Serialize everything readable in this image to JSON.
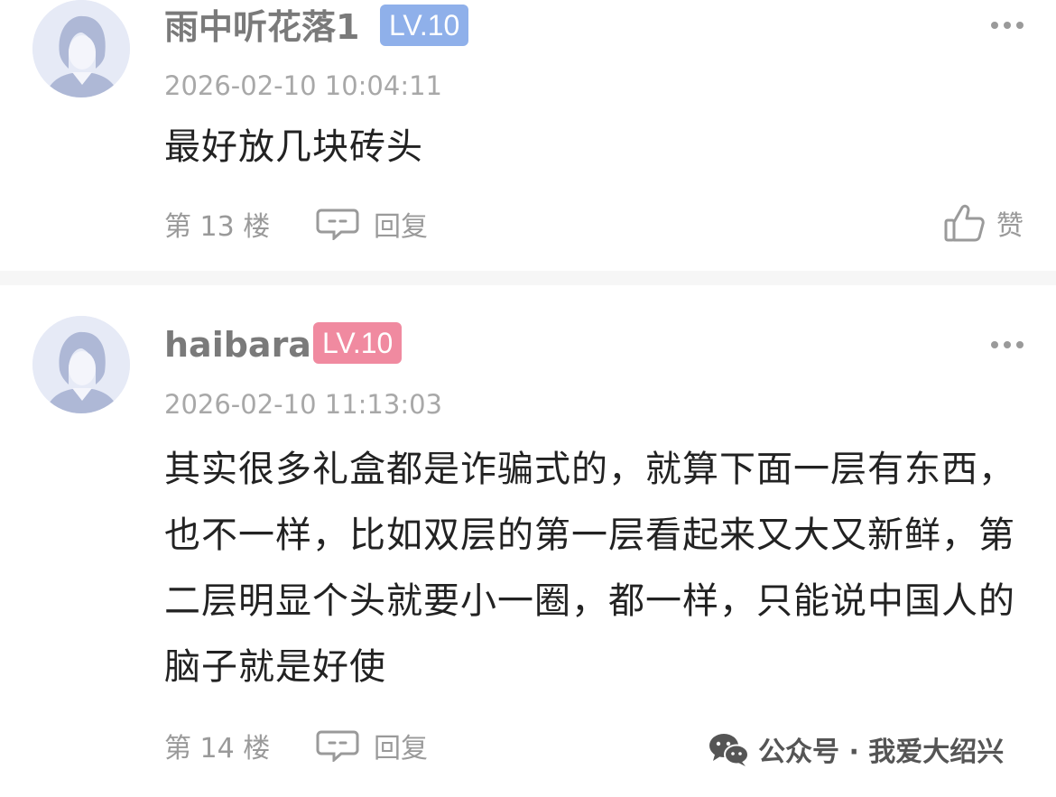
{
  "comments": [
    {
      "username": "雨中听花落1",
      "level": "LV.10",
      "timestamp": "2026-02-10 10:04:11",
      "content": "最好放几块砖头",
      "floor": "第 13 楼",
      "reply_label": "回复",
      "like_label": "赞"
    },
    {
      "username": "haibara",
      "level": "LV.10",
      "timestamp": "2026-02-10 11:13:03",
      "content": "其实很多礼盒都是诈骗式的，就算下面一层有东西，也不一样，比如双层的第一层看起来又大又新鲜，第二层明显个头就要小一圈，都一样，只能说中国人的脑子就是好使",
      "floor": "第 14 楼",
      "reply_label": "回复"
    }
  ],
  "watermark": {
    "text": "公众号 · 我爱大绍兴",
    "icon": "wechat-icon"
  },
  "icons": {
    "more": "more-dots-icon",
    "reply": "comment-bubble-icon",
    "like": "thumbs-up-icon"
  },
  "colors": {
    "level_badge_1": "#8fb0ea",
    "level_badge_2": "#f08aa0",
    "meta_text": "#9a9a9a",
    "content_text": "#222222"
  }
}
